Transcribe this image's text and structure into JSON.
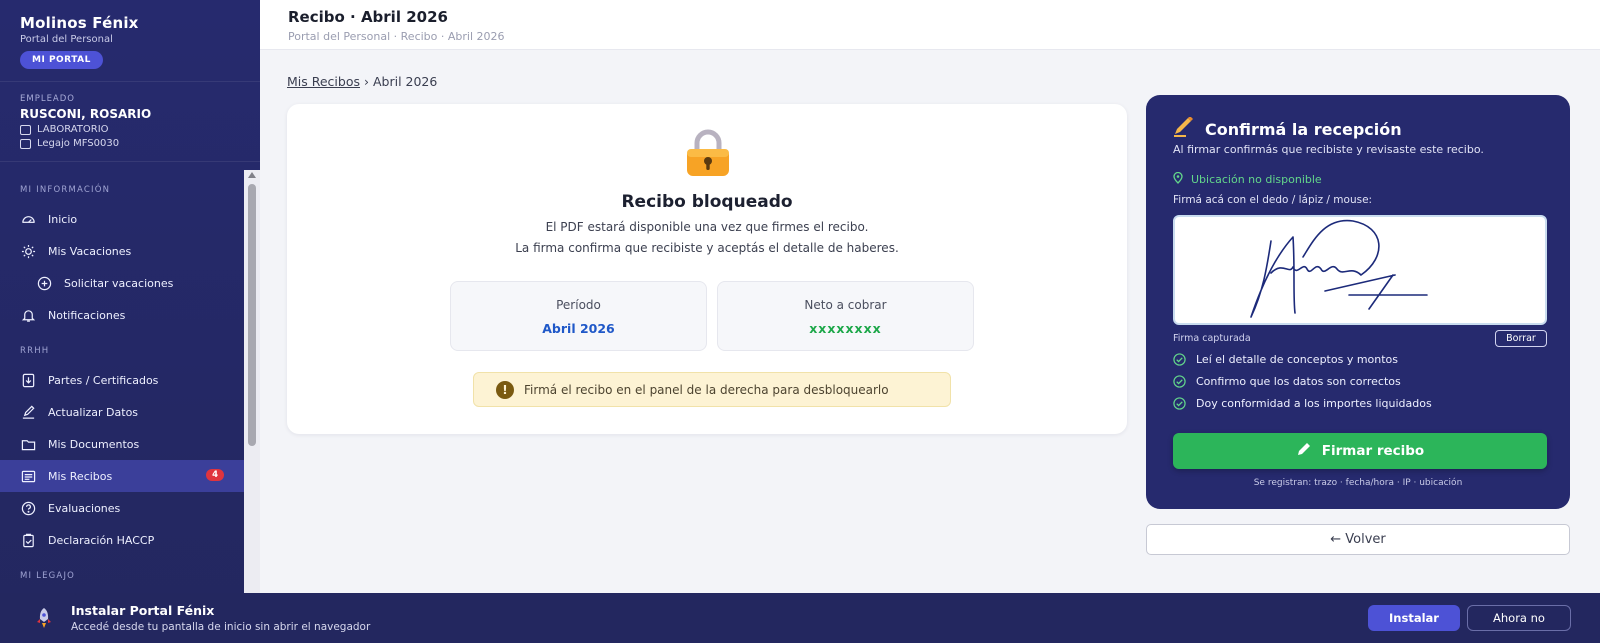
{
  "sidebar": {
    "brand_title": "Molinos Fénix",
    "brand_sub": "Portal del Personal",
    "portal_pill": "MI PORTAL",
    "employee": {
      "label": "EMPLEADO",
      "name": "RUSCONI, ROSARIO",
      "area": "LABORATORIO",
      "legajo": "Legajo MFS0030"
    },
    "sections": {
      "info": "MI INFORMACIÓN",
      "rrhh": "RRHH",
      "legajo": "MI LEGAJO"
    },
    "items": {
      "inicio": "Inicio",
      "vacaciones": "Mis Vacaciones",
      "solicitar": "Solicitar vacaciones",
      "notificaciones": "Notificaciones",
      "partes": "Partes / Certificados",
      "actualizar": "Actualizar Datos",
      "documentos": "Mis Documentos",
      "recibos": "Mis Recibos",
      "recibos_badge": "4",
      "evaluaciones": "Evaluaciones",
      "haccp": "Declaración HACCP"
    }
  },
  "header": {
    "title": "Recibo · Abril 2026",
    "crumbs": "Portal del Personal · Recibo · Abril 2026"
  },
  "breadcrumb": {
    "link": "Mis Recibos",
    "separator": "›",
    "current": "Abril 2026"
  },
  "locked": {
    "title": "Recibo bloqueado",
    "text1": "El PDF estará disponible una vez que firmes el recibo.",
    "text2": "La firma confirma que recibiste y aceptás el detalle de haberes.",
    "period_label": "Período",
    "period_value": "Abril 2026",
    "net_label": "Neto a cobrar",
    "net_value": "xxxxxxxx",
    "warning": "Firmá el recibo en el panel de la derecha para desbloquearlo"
  },
  "signature": {
    "title": "Confirmá la recepción",
    "subtitle": "Al firmar confirmás que recibiste y revisaste este recibo.",
    "location": "Ubicación no disponible",
    "instruction": "Firmá acá con el dedo / lápiz / mouse:",
    "caption": "Firma capturada",
    "clear": "Borrar",
    "checks": [
      "Leí el detalle de conceptos y montos",
      "Confirmo que los datos son correctos",
      "Doy conformidad a los importes liquidados"
    ],
    "button": "Firmar recibo",
    "footer": "Se registran: trazo · fecha/hora · IP · ubicación"
  },
  "back": "← Volver",
  "install": {
    "title": "Instalar Portal Fénix",
    "subtitle": "Accedé desde tu pantalla de inicio sin abrir el navegador",
    "install_btn": "Instalar",
    "later_btn": "Ahora no"
  },
  "colors": {
    "sidebar": "#262a6e",
    "accent": "#4d52d6",
    "success": "#2cb55a",
    "period": "#1f58c8"
  }
}
